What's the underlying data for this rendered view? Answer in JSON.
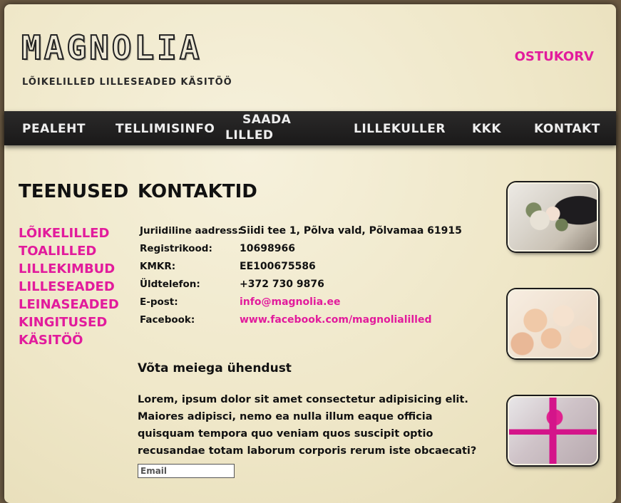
{
  "header": {
    "logo": "MAGNOLIA",
    "tagline": "LÕIKELILLED LILLESEADED KÄSITÖÖ",
    "cart_label": "OSTUKORV"
  },
  "nav": {
    "items": [
      {
        "label": "PEALEHT"
      },
      {
        "label": "TELLIMISINFO"
      },
      {
        "line1": "SAADA",
        "line2": "LILLED"
      },
      {
        "label": "LILLEKULLER"
      },
      {
        "label": "KKK"
      },
      {
        "label": "KONTAKT"
      }
    ]
  },
  "sidebar": {
    "heading": "TEENUSED",
    "items": [
      "LÕIKELILLED",
      "TOALILLED",
      "LILLEKIMBUD",
      "LILLESEADED",
      "LEINASEADED",
      "KINGITUSED",
      "KÄSITÖÖ"
    ]
  },
  "main": {
    "heading": "KONTAKTID",
    "contacts": [
      {
        "label": "Juriidiline aadress:",
        "value": "Siidi tee 1, Põlva vald, Põlvamaa 61915"
      },
      {
        "label": "Registrikood:",
        "value": "10698966"
      },
      {
        "label": "KMKR:",
        "value": "EE100675586"
      },
      {
        "label": "Üldtelefon:",
        "value": "+372 730 9876"
      },
      {
        "label": "E-post:",
        "value": "info@magnolia.ee"
      },
      {
        "label": "Facebook:",
        "value": "www.facebook.com/magnolialilled"
      }
    ],
    "contact_heading": "Võta meiega ühendust",
    "paragraph": "Lorem, ipsum dolor sit amet consectetur adipisicing elit. Maiores adipisci, nemo ea nulla illum eaque officia quisquam tempora quo veniam quos suscipit optio recusandae totam laborum corporis rerum iste obcaecati?",
    "email_placeholder": "Email"
  },
  "colors": {
    "accent": "#e21b9c",
    "nav_bg": "#1f1e1e",
    "text": "#111111"
  }
}
